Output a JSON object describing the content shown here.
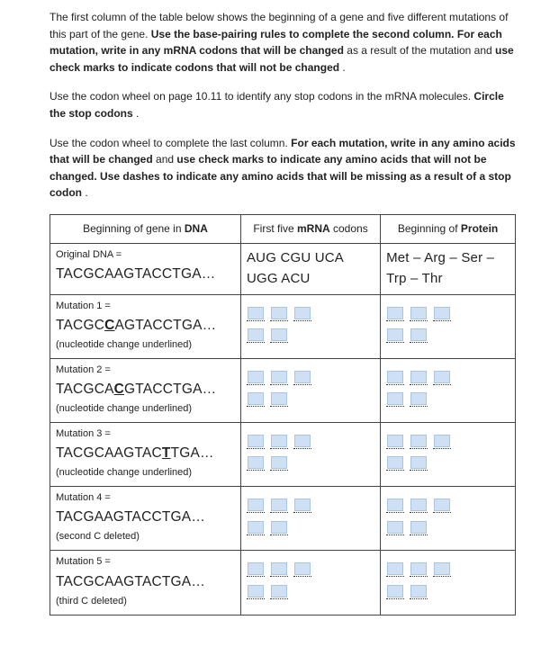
{
  "instructions": {
    "p1_plain1": "The first column of the table below shows the beginning of a gene and five different mutations of this part of the gene. ",
    "p1_bold1": "Use the base-pairing rules to complete the second column.  For each mutation, write in any mRNA codons that will be changed",
    "p1_plain2": " as a result of the mutation and ",
    "p1_bold2": "use check marks to indicate codons that will not be changed",
    "p1_plain3": ".",
    "p2_plain1": "Use the codon wheel on page 10.11 to identify any stop codons in the mRNA molecules. ",
    "p2_bold1": "Circle the stop codons",
    "p2_plain2": ".",
    "p3_plain1": "Use the codon wheel to complete the last column. ",
    "p3_bold1": "For each mutation, write in any amino acids that will be changed",
    "p3_plain2": " and ",
    "p3_bold2": "use check marks to indicate any amino acids that will not be changed.  Use dashes to indicate any amino acids that will be missing as a result of a stop codon",
    "p3_plain3": "."
  },
  "table": {
    "headers": {
      "col1_a": "Beginning of gene in ",
      "col1_b": "DNA",
      "col2_a": "First five ",
      "col2_b": "mRNA",
      "col2_c": " codons",
      "col3_a": "Beginning of ",
      "col3_b": "Protein"
    },
    "rows": [
      {
        "label": "Original DNA =",
        "dna_pre": "TACGCAAGTACCTGA",
        "dna_ul": "",
        "dna_post": "…",
        "note": "",
        "mrna_text": "AUG CGU UCA UGG ACU",
        "prot_text": "Met – Arg – Ser – Trp – Thr",
        "blank_mode": false
      },
      {
        "label": "Mutation 1 =",
        "dna_pre": "TACGC",
        "dna_ul": "C",
        "dna_post": "AGTACCTGA…",
        "note": "(nucleotide change underlined)",
        "blank_mode": true,
        "mrna_groups": [
          1,
          1,
          1,
          1,
          1
        ],
        "prot_groups": [
          1,
          1,
          1,
          1,
          1
        ]
      },
      {
        "label": "Mutation 2 =",
        "dna_pre": "TACGCA",
        "dna_ul": "C",
        "dna_post": "GTACCTGA…",
        "note": "(nucleotide change underlined)",
        "blank_mode": true,
        "mrna_groups": [
          1,
          1,
          1,
          1,
          1
        ],
        "prot_groups": [
          1,
          1,
          1,
          1,
          1
        ]
      },
      {
        "label": "Mutation 3 =",
        "dna_pre": "TACGCAAGTAC",
        "dna_ul": "T",
        "dna_post": "TGA…",
        "note": "(nucleotide change underlined)",
        "blank_mode": true,
        "mrna_groups": [
          1,
          1,
          1,
          1,
          1
        ],
        "prot_groups": [
          1,
          1,
          1,
          1,
          1
        ]
      },
      {
        "label": "Mutation 4 =",
        "dna_pre": "TACGAAGTACCTGA…",
        "dna_ul": "",
        "dna_post": "",
        "note": "(second C deleted)",
        "blank_mode": true,
        "mrna_groups": [
          1,
          1,
          1,
          1,
          1
        ],
        "prot_groups": [
          1,
          1,
          1,
          1,
          1
        ]
      },
      {
        "label": "Mutation 5 =",
        "dna_pre": "TACGCAAGTACTGA…",
        "dna_ul": "",
        "dna_post": "",
        "note": "(third C deleted)",
        "blank_mode": true,
        "mrna_groups": [
          1,
          1,
          1,
          1,
          1
        ],
        "prot_groups": [
          1,
          1,
          1,
          1,
          1
        ]
      }
    ]
  }
}
